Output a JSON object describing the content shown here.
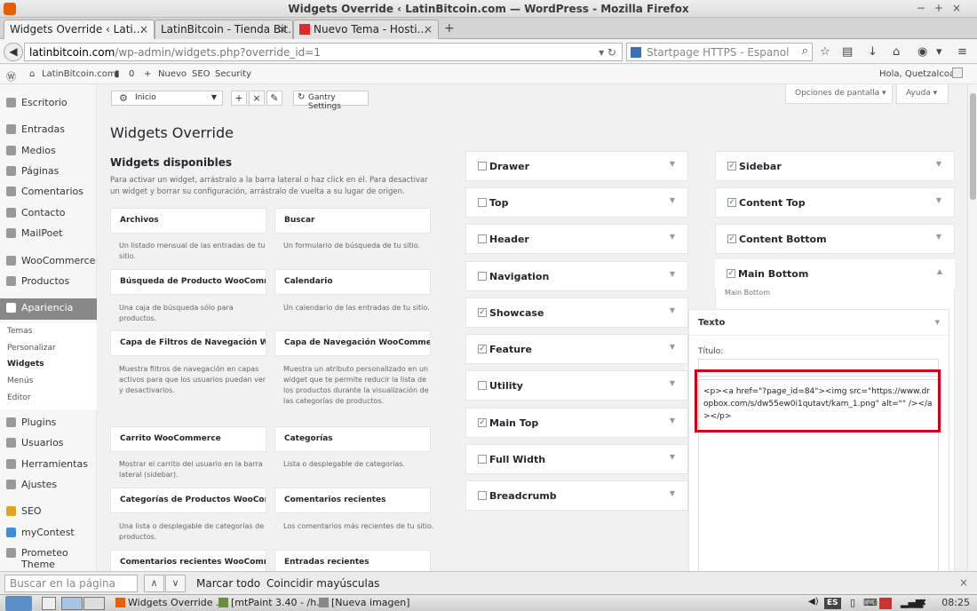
{
  "window": {
    "title": "Widgets Override ‹ LatinBitcoin.com — WordPress - Mozilla Firefox"
  },
  "tabs": [
    {
      "label": "Widgets Override ‹ Lati…"
    },
    {
      "label": "LatinBitcoin - Tienda Bit…"
    },
    {
      "label": "Nuevo Tema - Hosti…"
    }
  ],
  "nav": {
    "url_host": "latinbitcoin.com",
    "url_path": "/wp-admin/widgets.php?override_id=1",
    "search_placeholder": "Startpage HTTPS - Espanol"
  },
  "adminbar": {
    "site": "LatinBitcoin.com",
    "comments": "0",
    "new": "Nuevo",
    "seo": "SEO",
    "security": "Security",
    "greeting": "Hola, Quetzalcoatl"
  },
  "sidebar": {
    "items": [
      {
        "label": "Escritorio"
      },
      {
        "label": "Entradas"
      },
      {
        "label": "Medios"
      },
      {
        "label": "Páginas"
      },
      {
        "label": "Comentarios"
      },
      {
        "label": "Contacto"
      },
      {
        "label": "MailPoet"
      },
      {
        "label": "WooCommerce"
      },
      {
        "label": "Productos"
      },
      {
        "label": "Apariencia"
      },
      {
        "label": "Plugins"
      },
      {
        "label": "Usuarios"
      },
      {
        "label": "Herramientas"
      },
      {
        "label": "Ajustes"
      },
      {
        "label": "SEO"
      },
      {
        "label": "myContest"
      },
      {
        "label": "Prometeo Theme"
      }
    ],
    "sub": [
      "Temas",
      "Personalizar",
      "Widgets",
      "Menús",
      "Editor"
    ]
  },
  "toolbar": {
    "inicio": "Inicio",
    "gantry": "Gantry Settings",
    "screen_options": "Opciones de pantalla",
    "help": "Ayuda"
  },
  "page": {
    "title": "Widgets Override",
    "available_title": "Widgets disponibles",
    "available_desc": "Para activar un widget, arrástralo a la barra lateral o haz click en él. Para desactivar un widget y borrar su configuración, arrástralo de vuelta a su lugar de origen."
  },
  "widgets": [
    {
      "name": "Archivos",
      "desc": "Un listado mensual de las entradas de tu sitio."
    },
    {
      "name": "Buscar",
      "desc": "Un formulario de búsqueda de tu sitio."
    },
    {
      "name": "Búsqueda de Producto WooComm…",
      "desc": "Una caja de búsqueda sólo para productos."
    },
    {
      "name": "Calendario",
      "desc": "Un calendario de las entradas de tu sitio."
    },
    {
      "name": "Capa de Filtros de Navegación Wo…",
      "desc": "Muestra filtros de navegación en capas activos para que los usuarios puedan ver y desactivarlos."
    },
    {
      "name": "Capa de Navegación WooCommerce",
      "desc": "Muestra un atributo personalizado en un widget que te permite reducir la lista de los productos durante la visualización de las categorías de productos."
    },
    {
      "name": "Carrito WooCommerce",
      "desc": "Mostrar el carrito del usuario en la barra lateral (sidebar)."
    },
    {
      "name": "Categorías",
      "desc": "Lista o desplegable de categorías."
    },
    {
      "name": "Categorías de Productos WooCom…",
      "desc": "Una lista o desplegable de categorías de productos."
    },
    {
      "name": "Comentarios recientes",
      "desc": "Los comentarios más recientes de tu sitio."
    },
    {
      "name": "Comentarios recientes WooComm…",
      "desc": ""
    },
    {
      "name": "Entradas recientes",
      "desc": ""
    }
  ],
  "areas_left": [
    {
      "name": "Drawer",
      "checked": false
    },
    {
      "name": "Top",
      "checked": false
    },
    {
      "name": "Header",
      "checked": false
    },
    {
      "name": "Navigation",
      "checked": false
    },
    {
      "name": "Showcase",
      "checked": true
    },
    {
      "name": "Feature",
      "checked": true
    },
    {
      "name": "Utility",
      "checked": false
    },
    {
      "name": "Main Top",
      "checked": true
    },
    {
      "name": "Full Width",
      "checked": false
    },
    {
      "name": "Breadcrumb",
      "checked": false
    }
  ],
  "areas_right": [
    {
      "name": "Sidebar",
      "checked": true
    },
    {
      "name": "Content Top",
      "checked": true
    },
    {
      "name": "Content Bottom",
      "checked": true
    },
    {
      "name": "Main Bottom",
      "checked": true
    }
  ],
  "main_bottom": {
    "subtitle": "Main Bottom"
  },
  "text_widget": {
    "title": "Texto",
    "title_label": "Título:",
    "content": "<p><a href=\"?page_id=84\"><img src=\"https://www.dropbox.com/s/dw55ew0i1qutavt/kam_1.png\" alt=\"\" /></a></p>"
  },
  "findbar": {
    "placeholder": "Buscar en la página",
    "highlight_all": "Marcar todo",
    "match_case": "Coincidir mayúsculas"
  },
  "taskbar": {
    "items": [
      "Widgets Override …",
      "[mtPaint 3.40 - /h…",
      "[Nueva imagen]"
    ],
    "lang": "ES",
    "clock": "08:25"
  }
}
